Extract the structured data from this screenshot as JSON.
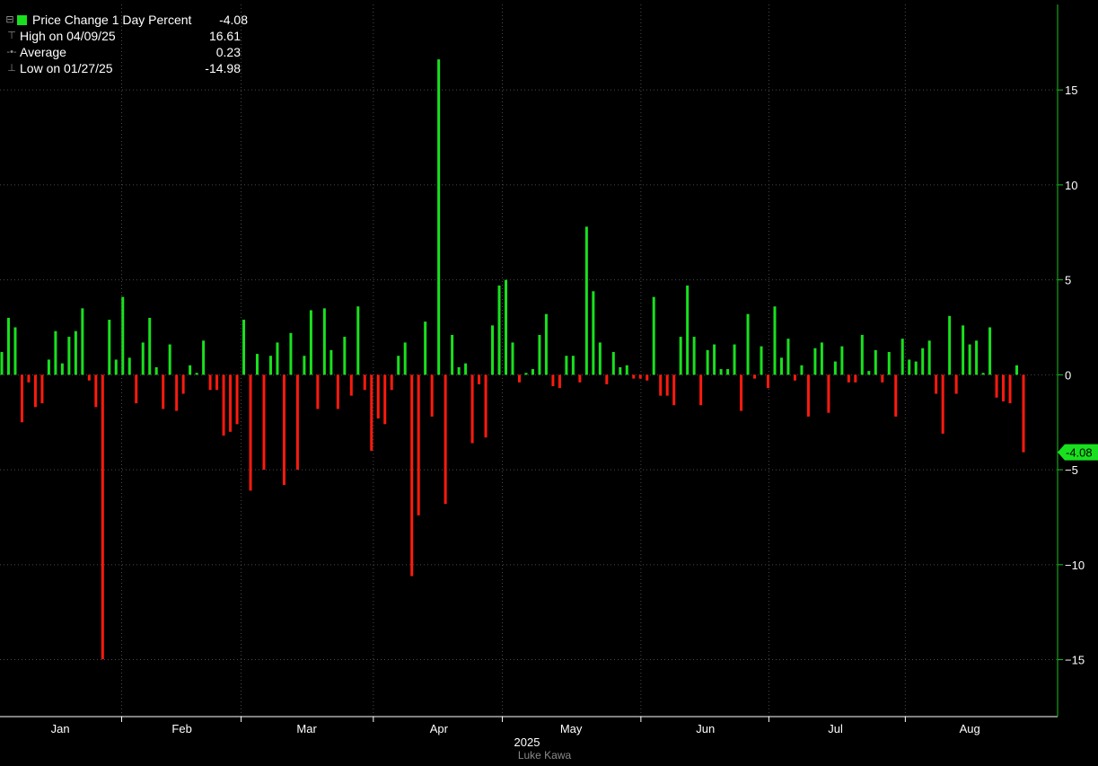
{
  "legend": {
    "series_label": "Price Change 1 Day Percent",
    "series_value": "-4.08",
    "high_label": "High on 04/09/25",
    "high_value": "16.61",
    "avg_label": "Average",
    "avg_value": "0.23",
    "low_label": "Low on 01/27/25",
    "low_value": "-14.98"
  },
  "credit": "Luke Kawa",
  "colors": {
    "positive": "#19e01e",
    "negative": "#ff1a0e",
    "axis": "#19c21b",
    "grid": "#4a4a4a",
    "last_tag": "#19e01e"
  },
  "chart_data": {
    "type": "bar",
    "title": "",
    "xlabel": "2025",
    "ylabel": "",
    "ylim": [
      -18,
      19.5
    ],
    "yticks": [
      15,
      10,
      5,
      0,
      -5,
      -10,
      -15
    ],
    "month_labels": [
      "Jan",
      "Feb",
      "Mar",
      "Apr",
      "May",
      "Jun",
      "Jul",
      "Aug"
    ],
    "last_value_label": "-4.08",
    "series": [
      {
        "name": "Price Change 1 Day Percent",
        "values": [
          1.2,
          3.0,
          2.5,
          -2.5,
          -0.4,
          -1.7,
          -1.5,
          0.8,
          2.3,
          0.6,
          2.0,
          2.3,
          3.5,
          -0.3,
          -1.7,
          -14.98,
          2.9,
          0.8,
          4.1,
          0.9,
          -1.5,
          1.7,
          3.0,
          0.4,
          -1.8,
          1.6,
          -1.9,
          -1.0,
          0.5,
          0.1,
          1.8,
          -0.8,
          -0.8,
          -3.2,
          -3.0,
          -2.6,
          2.9,
          -6.1,
          1.1,
          -5.0,
          1.0,
          1.7,
          -5.8,
          2.2,
          -5.0,
          1.0,
          3.4,
          -1.8,
          3.5,
          1.3,
          -1.8,
          2.0,
          -1.1,
          3.6,
          -0.8,
          -4.0,
          -2.3,
          -2.6,
          -0.8,
          1.0,
          1.7,
          -10.6,
          -7.4,
          2.8,
          -2.2,
          16.61,
          -6.8,
          2.1,
          0.4,
          0.6,
          -3.6,
          -0.5,
          -3.3,
          2.6,
          4.7,
          5.0,
          1.7,
          -0.4,
          0.1,
          0.3,
          2.1,
          3.2,
          -0.6,
          -0.7,
          1.0,
          1.0,
          -0.4,
          7.8,
          4.4,
          1.7,
          -0.5,
          1.2,
          0.4,
          0.5,
          -0.2,
          -0.2,
          -0.3,
          4.1,
          -1.1,
          -1.1,
          -1.6,
          2.0,
          4.7,
          2.0,
          -1.6,
          1.3,
          1.6,
          0.3,
          0.3,
          1.6,
          -1.9,
          3.2,
          -0.2,
          1.5,
          -0.7,
          3.6,
          0.9,
          1.9,
          -0.3,
          0.5,
          -2.2,
          1.4,
          1.7,
          -2.0,
          0.7,
          1.5,
          -0.4,
          -0.4,
          2.1,
          0.2,
          1.3,
          -0.4,
          1.2,
          -2.2,
          1.9,
          0.8,
          0.7,
          1.4,
          1.8,
          -1.0,
          -3.1,
          3.1,
          -1.0,
          2.6,
          1.6,
          1.8,
          0.1,
          2.5,
          -1.2,
          -1.4,
          -1.5,
          0.5,
          -4.08
        ]
      }
    ]
  }
}
